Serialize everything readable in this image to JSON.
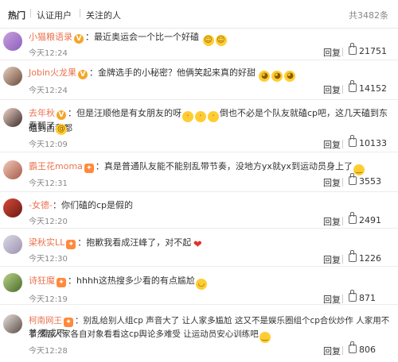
{
  "tabs": [
    {
      "label": "热门"
    },
    {
      "label": "认证用户"
    },
    {
      "label": "关注的人"
    }
  ],
  "total_count": "共3482条",
  "reply_label": "回复",
  "comments": [
    {
      "user": "小猫粮语录",
      "text": "：最近奥运会一个比一个好磕",
      "time": "今天12:24",
      "likes": "21751"
    },
    {
      "user": "Jobin火龙果",
      "text": "：金牌选手的小秘密？他俩笑起来真的好甜",
      "time": "今天12:24",
      "likes": "14152"
    },
    {
      "user": "去年秋",
      "text": "：但是汪顺他是有女朋友的呀",
      "text2": "倒也不必是个队友就磕cp吧，这几天磕到东磕到西我都",
      "text3": "看瓢了",
      "time": "今天12:09",
      "likes": "10133"
    },
    {
      "user": "霸王花moma",
      "text": "：真是普通队友能不能别乱带节奏，没地方yx就yx到运动员身上了",
      "time": "今天12:31",
      "likes": "3553"
    },
    {
      "user": "-女德-",
      "text": "：你们磕的cp是假的",
      "time": "今天12:20",
      "likes": "2491"
    },
    {
      "user": "梁秋实LL",
      "text": "：抱歉我看成汪峰了，对不起",
      "time": "今天12:30",
      "likes": "1226"
    },
    {
      "user": "诗狂魔",
      "text": "：hhhh这热搜多少看的有点尴尬",
      "time": "今天12:19",
      "likes": "871"
    },
    {
      "user": "柯南网王",
      "text": "：别乱给别人组cp 声音大了 让人家多尴尬 这又不是娱乐圈组个cp合伙炒作 人家用不着 要成不",
      "text2": "了然后人家各自对象看看这cp舆论多难受 让运动员安心训练吧",
      "time": "今天12:28",
      "likes": "806"
    }
  ]
}
